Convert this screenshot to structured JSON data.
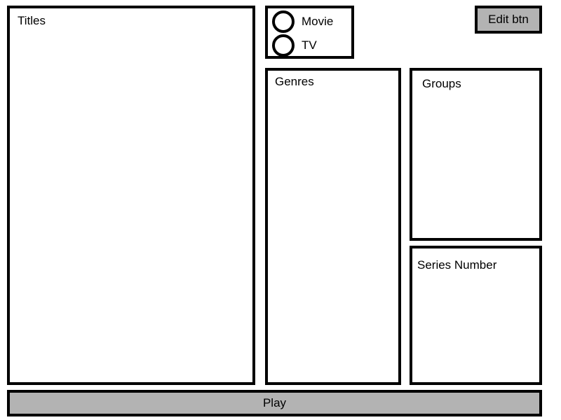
{
  "panels": {
    "titles": "Titles",
    "genres": "Genres",
    "groups": "Groups",
    "series_number": "Series Number"
  },
  "media_type": {
    "options": [
      "Movie",
      "TV"
    ]
  },
  "buttons": {
    "edit": "Edit btn",
    "play": "Play"
  },
  "colors": {
    "button_fill": "#b3b3b3",
    "border": "#000000"
  }
}
